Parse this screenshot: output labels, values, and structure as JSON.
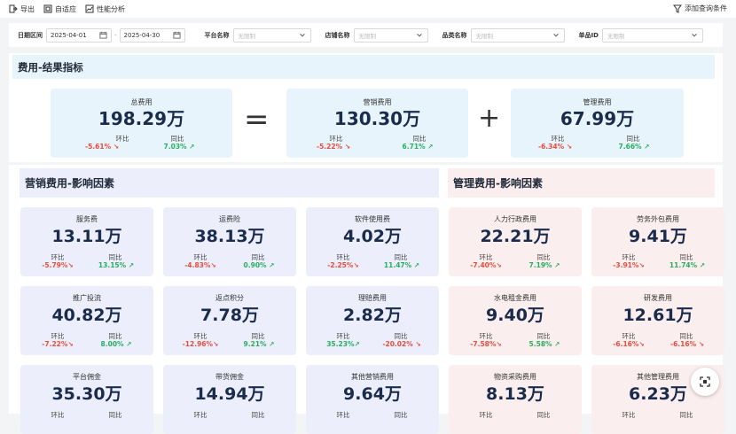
{
  "toolbar": {
    "export": "导出",
    "adaptive": "自适应",
    "perf": "性能分析",
    "add_filter": "添加查询条件"
  },
  "filters": {
    "date_label": "日期区间",
    "date_start": "2025-04-01",
    "date_end": "2025-04-30",
    "platform_label": "平台名称",
    "store_label": "店铺名称",
    "category_label": "品类名称",
    "sku_label": "单品ID",
    "placeholder": "无限制"
  },
  "result": {
    "title": "费用-结果指标",
    "total": {
      "name": "总费用",
      "value": "198.29万",
      "mom_label": "环比",
      "mom": "-5.61%",
      "yoy_label": "同比",
      "yoy": "7.03%"
    },
    "marketing": {
      "name": "营销费用",
      "value": "130.30万",
      "mom_label": "环比",
      "mom": "-5.22%",
      "yoy_label": "同比",
      "yoy": "6.71%"
    },
    "management": {
      "name": "管理费用",
      "value": "67.99万",
      "mom_label": "环比",
      "mom": "-6.34%",
      "yoy_label": "同比",
      "yoy": "7.66%"
    },
    "equals": "=",
    "plus": "+"
  },
  "marketing_section": {
    "title": "营销费用-影响因素"
  },
  "management_section": {
    "title": "管理费用-影响因素"
  },
  "cards": [
    {
      "name": "服务费",
      "value": "13.11万",
      "mom": "-5.79%",
      "yoy": "13.15%"
    },
    {
      "name": "运费险",
      "value": "38.13万",
      "mom": "-4.83%",
      "yoy": "0.90%"
    },
    {
      "name": "软件使用费",
      "value": "4.02万",
      "mom": "-2.25%",
      "yoy": "11.47%"
    },
    {
      "name": "人力行政费用",
      "value": "22.21万",
      "mom": "-7.40%",
      "yoy": "7.19%"
    },
    {
      "name": "劳务外包费用",
      "value": "9.41万",
      "mom": "-3.91%",
      "yoy": "11.74%"
    },
    {
      "name": "推广投流",
      "value": "40.82万",
      "mom": "-7.22%",
      "yoy": "8.00%"
    },
    {
      "name": "返点积分",
      "value": "7.78万",
      "mom": "-12.96%",
      "yoy": "9.21%"
    },
    {
      "name": "理赔费用",
      "value": "2.82万",
      "mom": "35.23%",
      "yoy": "-20.02%"
    },
    {
      "name": "水电租金费用",
      "value": "9.40万",
      "mom": "-7.58%",
      "yoy": "5.58%"
    },
    {
      "name": "研发费用",
      "value": "12.61万",
      "mom": "-6.16%",
      "yoy": "-6.16%"
    },
    {
      "name": "平台佣金",
      "value": "35.30万",
      "mom": "",
      "yoy": ""
    },
    {
      "name": "带货佣金",
      "value": "14.94万",
      "mom": "",
      "yoy": ""
    },
    {
      "name": "其他营销费用",
      "value": "9.64万",
      "mom": "",
      "yoy": ""
    },
    {
      "name": "物资采购费用",
      "value": "8.13万",
      "mom": "",
      "yoy": ""
    },
    {
      "name": "其他管理费用",
      "value": "6.23万",
      "mom": "",
      "yoy": ""
    }
  ],
  "labels": {
    "mom": "环比",
    "yoy": "同比"
  },
  "colors": {
    "marketing_bg": "#eceefb",
    "management_bg": "#fbeeee",
    "result_bg": "#e8f4fb",
    "negative": "#e74c3c",
    "positive": "#27ae60"
  }
}
